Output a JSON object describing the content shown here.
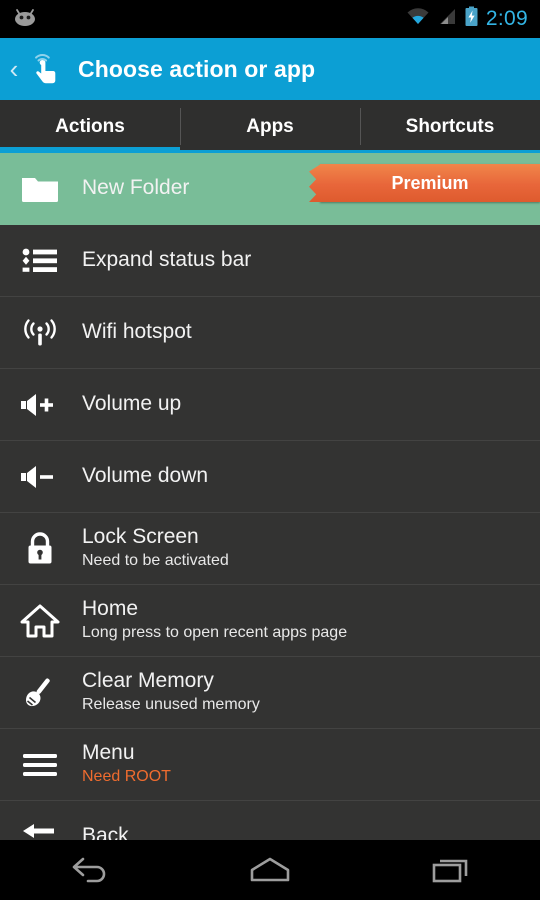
{
  "statusbar": {
    "mascot_icon": "android-mascot-icon",
    "wifi_icon": "wifi-icon",
    "signal_icon": "cell-signal-icon",
    "battery_icon": "battery-charging-icon",
    "clock": "2:09",
    "clock_color": "#33b5e5"
  },
  "actionbar": {
    "back_chevron": "‹",
    "app_icon": "touch-gesture-icon",
    "title": "Choose action or app",
    "background_color": "#0c9fd4"
  },
  "tabs": {
    "items": [
      {
        "label": "Actions",
        "active": true
      },
      {
        "label": "Apps",
        "active": false
      },
      {
        "label": "Shortcuts",
        "active": false
      }
    ],
    "accent_color": "#0c9fd4"
  },
  "list": {
    "rows": [
      {
        "title": "New Folder",
        "subtitle": "",
        "icon": "folder-icon",
        "highlight": true,
        "highlight_color": "#79bd98",
        "badge": "Premium",
        "badge_color": "#e8663a"
      },
      {
        "title": "Expand status bar",
        "subtitle": "",
        "icon": "bulleted-list-icon",
        "highlight": false
      },
      {
        "title": "Wifi hotspot",
        "subtitle": "",
        "icon": "broadcast-antenna-icon",
        "highlight": false
      },
      {
        "title": "Volume up",
        "subtitle": "",
        "icon": "volume-up-icon",
        "highlight": false
      },
      {
        "title": "Volume down",
        "subtitle": "",
        "icon": "volume-down-icon",
        "highlight": false
      },
      {
        "title": "Lock Screen",
        "subtitle": "Need to be activated",
        "icon": "lock-icon",
        "highlight": false
      },
      {
        "title": "Home",
        "subtitle": "Long press to open recent apps page",
        "icon": "home-icon",
        "highlight": false
      },
      {
        "title": "Clear Memory",
        "subtitle": "Release unused memory",
        "icon": "broom-icon",
        "highlight": false
      },
      {
        "title": "Menu",
        "subtitle": "Need ROOT",
        "subtitle_warning": true,
        "subtitle_color": "#ef6c2f",
        "icon": "hamburger-menu-icon",
        "highlight": false
      },
      {
        "title": "Back",
        "subtitle": "",
        "icon": "back-arrow-icon",
        "highlight": false
      }
    ]
  },
  "navbar": {
    "back_icon": "nav-back-icon",
    "home_icon": "nav-home-icon",
    "recents_icon": "nav-recents-icon"
  }
}
